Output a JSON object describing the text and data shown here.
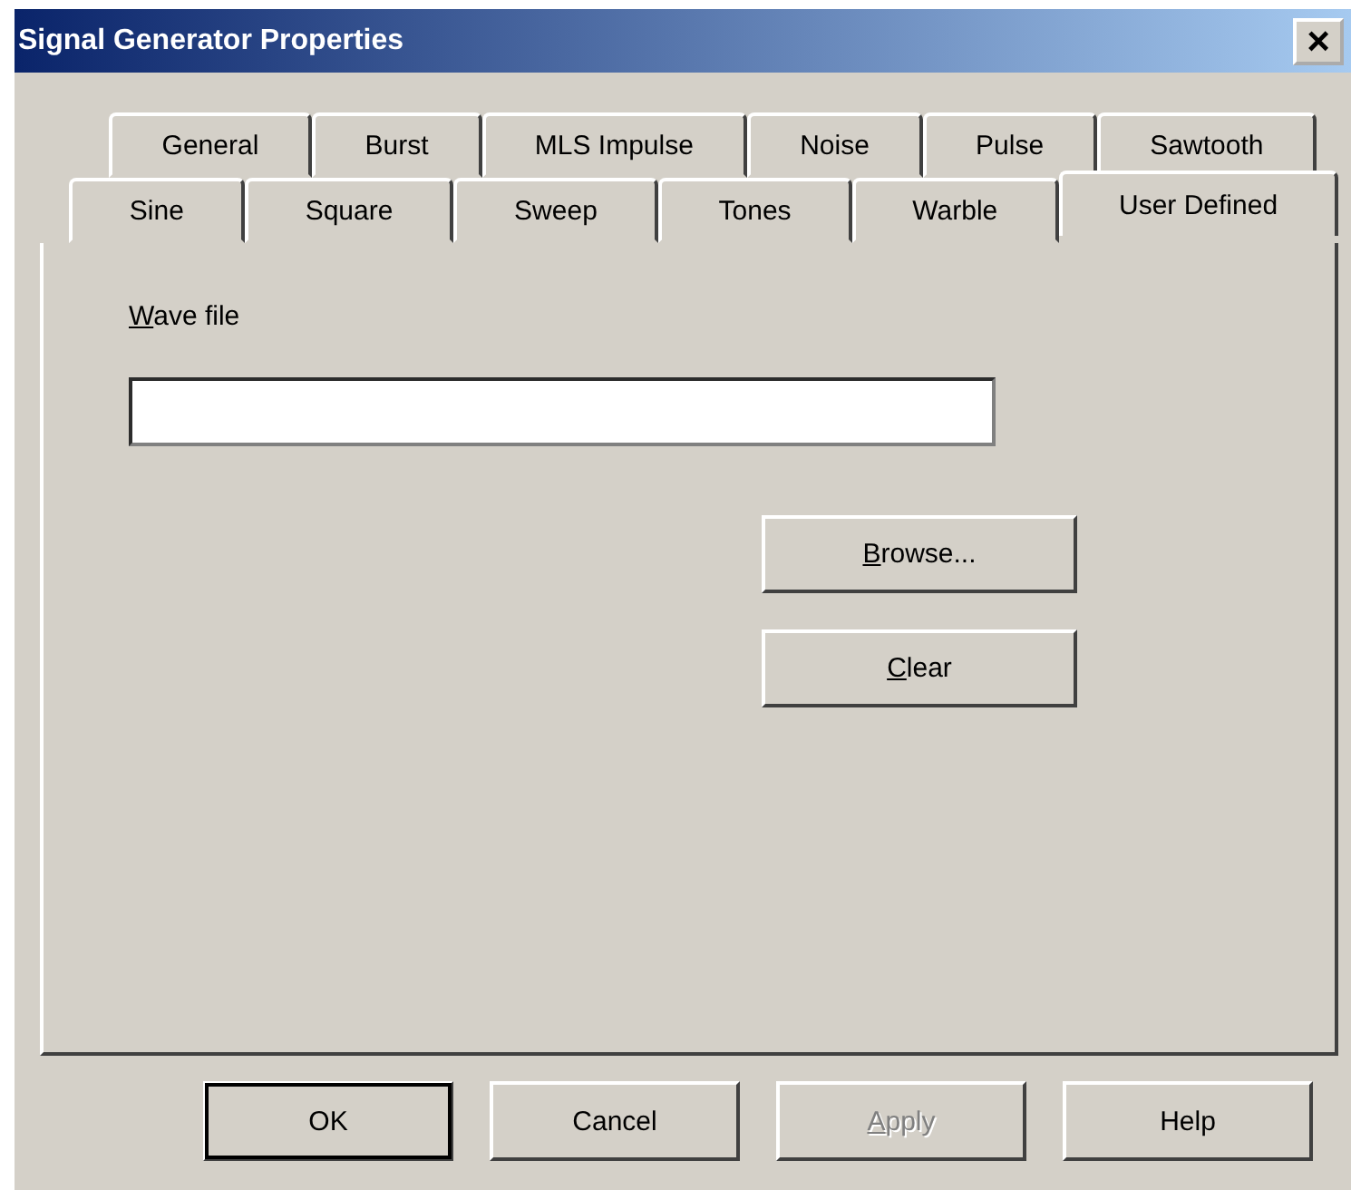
{
  "window": {
    "title": "Signal Generator Properties",
    "close": "×"
  },
  "tab_rows": [
    {
      "tabs": [
        {
          "label": "General",
          "selected": false
        },
        {
          "label": "Burst",
          "selected": false
        },
        {
          "label": "MLS Impulse",
          "selected": false
        },
        {
          "label": "Noise",
          "selected": false
        },
        {
          "label": "Pulse",
          "selected": false
        },
        {
          "label": "Sawtooth",
          "selected": false
        }
      ]
    },
    {
      "tabs": [
        {
          "label": "Sine",
          "selected": false
        },
        {
          "label": "Square",
          "selected": false
        },
        {
          "label": "Sweep",
          "selected": false
        },
        {
          "label": "Tones",
          "selected": false
        },
        {
          "label": "Warble",
          "selected": false
        },
        {
          "label": "User Defined",
          "selected": true
        }
      ]
    }
  ],
  "panel": {
    "wave_file": {
      "label": "Wave file",
      "underline_first": true
    },
    "buttons": [
      {
        "label": "Browse...",
        "underline_first": true
      },
      {
        "label": "Clear",
        "underline_first": true
      }
    ]
  },
  "buttons": [
    {
      "label": "OK",
      "default": true,
      "disabled": false,
      "underline_first": false
    },
    {
      "label": "Cancel",
      "default": false,
      "disabled": false,
      "underline_first": false
    },
    {
      "label": "Apply",
      "default": false,
      "disabled": true,
      "underline_first": true
    },
    {
      "label": "Help",
      "default": false,
      "disabled": false,
      "underline_first": false
    }
  ]
}
